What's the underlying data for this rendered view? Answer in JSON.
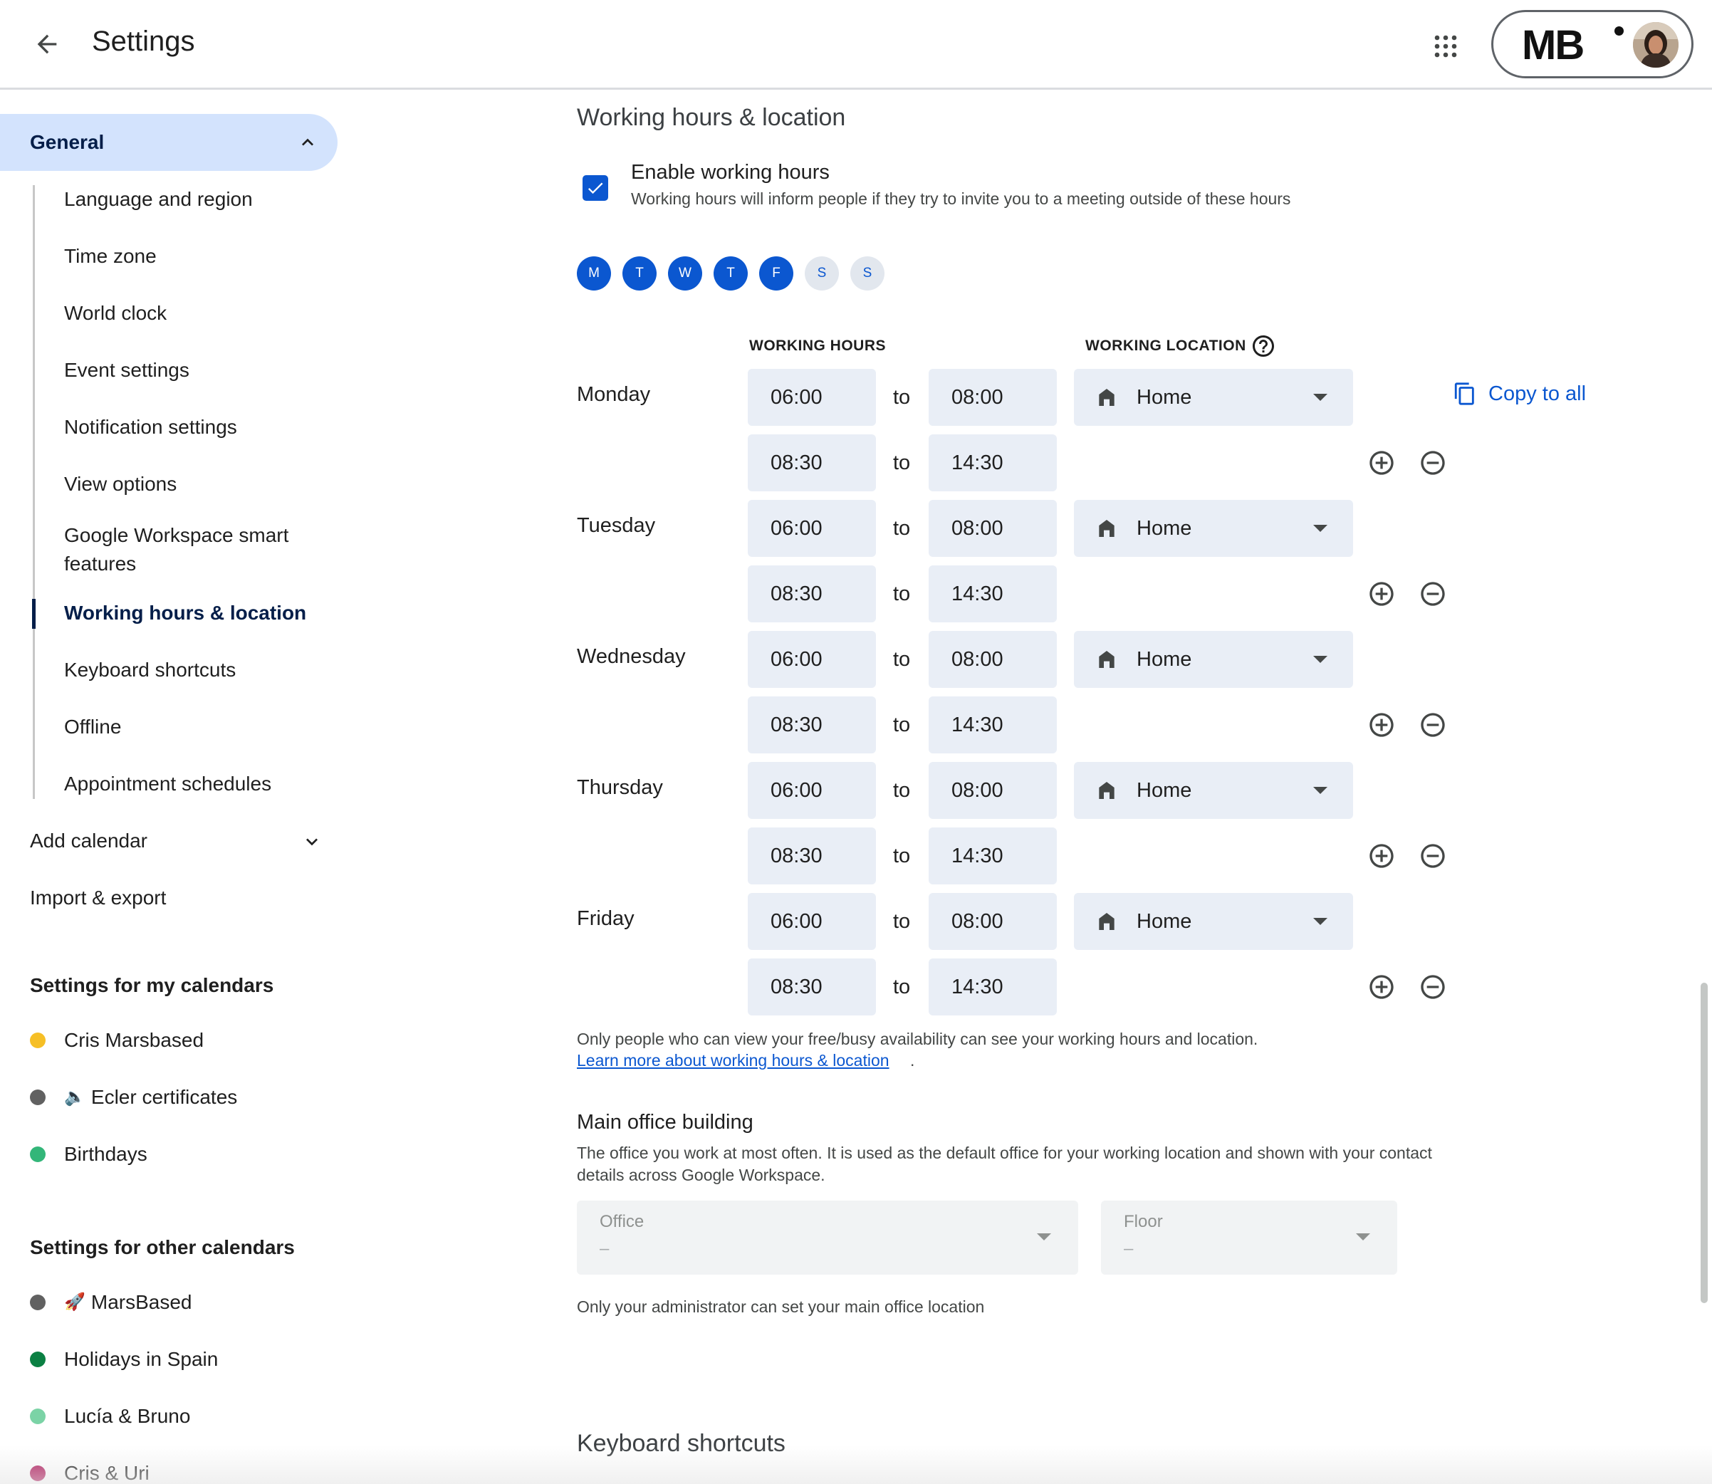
{
  "header": {
    "title": "Settings",
    "back_icon": "arrow-back-icon",
    "apps_icon": "apps-grid-icon",
    "account_logo": "MB"
  },
  "sidebar": {
    "general_label": "General",
    "general_sub": [
      "Language and region",
      "Time zone",
      "World clock",
      "Event settings",
      "Notification settings",
      "View options",
      "Google Workspace smart features",
      "Working hours & location",
      "Keyboard shortcuts",
      "Offline",
      "Appointment schedules"
    ],
    "active_sub": "Working hours & location",
    "add_calendar": "Add calendar",
    "import_export": "Import & export",
    "my_calendars_head": "Settings for my calendars",
    "my_calendars": [
      {
        "name": "Cris Marsbased",
        "color": "#f6bf26",
        "emoji": ""
      },
      {
        "name": "Ecler certificates",
        "color": "#616161",
        "emoji": "🔈"
      },
      {
        "name": "Birthdays",
        "color": "#33b679",
        "emoji": ""
      }
    ],
    "other_calendars_head": "Settings for other calendars",
    "other_calendars": [
      {
        "name": "MarsBased",
        "color": "#616161",
        "emoji": "🚀"
      },
      {
        "name": "Holidays in Spain",
        "color": "#0b8043",
        "emoji": ""
      },
      {
        "name": "Lucía & Bruno",
        "color": "#7bd3a6",
        "emoji": ""
      },
      {
        "name": "Cris & Uri",
        "color": "#ad1457",
        "emoji": ""
      }
    ]
  },
  "main": {
    "section_title": "Working hours & location",
    "enable_label": "Enable working hours",
    "enable_desc": "Working hours will inform people if they try to invite you to a meeting outside of these hours",
    "enable_checked": true,
    "day_pills": [
      {
        "letter": "M",
        "on": true
      },
      {
        "letter": "T",
        "on": true
      },
      {
        "letter": "W",
        "on": true
      },
      {
        "letter": "T",
        "on": true
      },
      {
        "letter": "F",
        "on": true
      },
      {
        "letter": "S",
        "on": false
      },
      {
        "letter": "S",
        "on": false
      }
    ],
    "col_working_hours": "WORKING HOURS",
    "col_working_location": "WORKING LOCATION",
    "to_label": "to",
    "copy_all": "Copy to all",
    "days": [
      {
        "name": "Monday",
        "slots": [
          [
            "06:00",
            "08:00"
          ],
          [
            "08:30",
            "14:30"
          ]
        ],
        "location": "Home"
      },
      {
        "name": "Tuesday",
        "slots": [
          [
            "06:00",
            "08:00"
          ],
          [
            "08:30",
            "14:30"
          ]
        ],
        "location": "Home"
      },
      {
        "name": "Wednesday",
        "slots": [
          [
            "06:00",
            "08:00"
          ],
          [
            "08:30",
            "14:30"
          ]
        ],
        "location": "Home"
      },
      {
        "name": "Thursday",
        "slots": [
          [
            "06:00",
            "08:00"
          ],
          [
            "08:30",
            "14:30"
          ]
        ],
        "location": "Home"
      },
      {
        "name": "Friday",
        "slots": [
          [
            "06:00",
            "08:00"
          ],
          [
            "08:30",
            "14:30"
          ]
        ],
        "location": "Home"
      }
    ],
    "info_text": "Only people who can view your free/busy availability can see your working hours and location.",
    "info_link": "Learn more about working hours & location",
    "info_period": ".",
    "office_title": "Main office building",
    "office_desc": "The office you work at most often. It is used as the default office for your working location and shown with your contact details across Google Workspace.",
    "office_field": {
      "label": "Office",
      "value": "–"
    },
    "floor_field": {
      "label": "Floor",
      "value": "–"
    },
    "admin_note": "Only your administrator can set your main office location",
    "next_section": "Keyboard shortcuts"
  },
  "colors": {
    "accent": "#0b57d0",
    "nav_active_bg": "#d3e3fd",
    "field_bg": "#e9eef6"
  }
}
